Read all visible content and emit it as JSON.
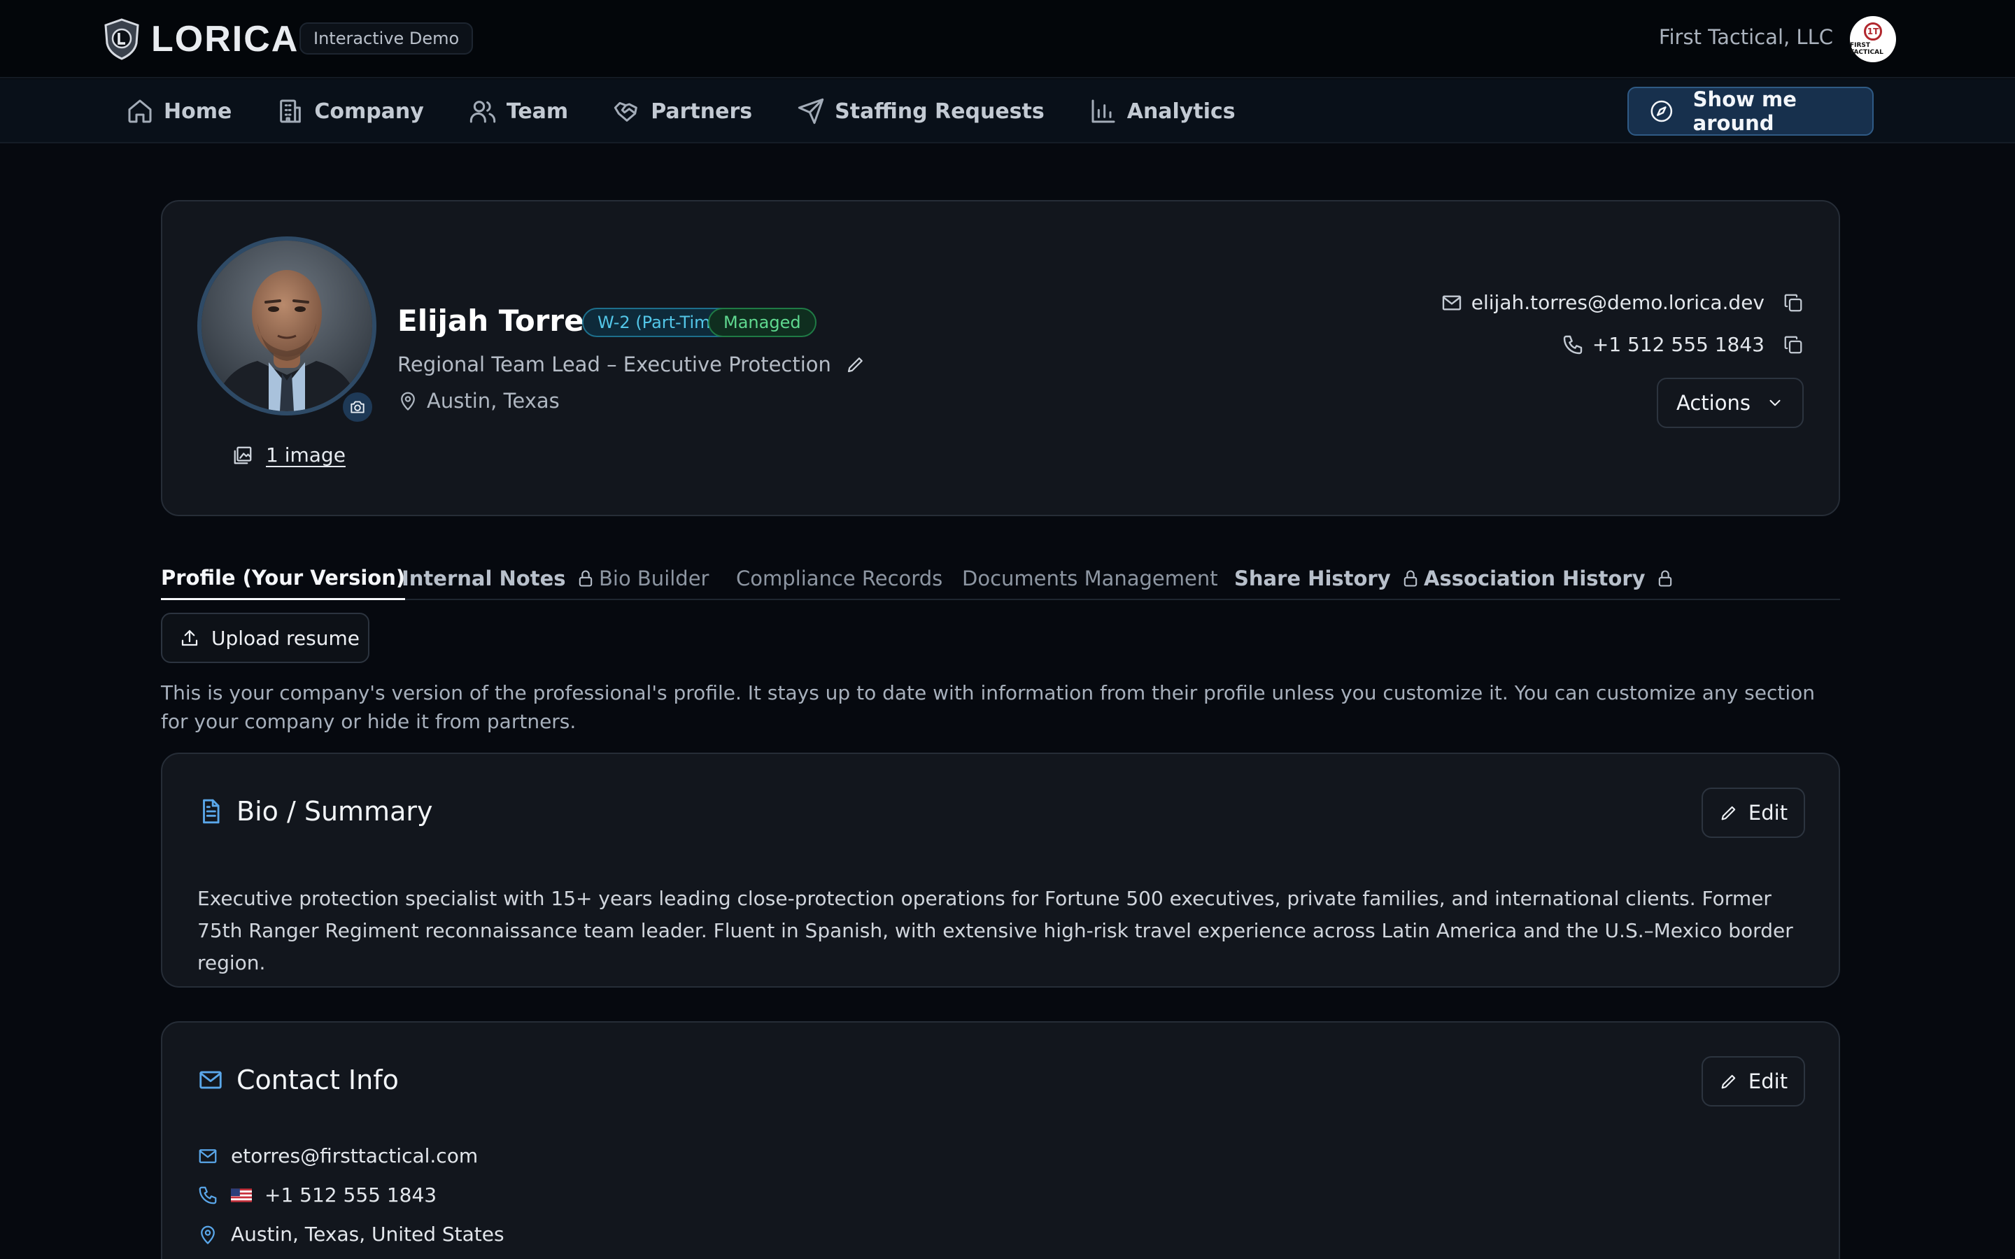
{
  "header": {
    "logo_text": "LORICA",
    "demo_badge": "Interactive Demo",
    "company_name": "First Tactical, LLC",
    "company_avatar_text": "FIRST TACTICAL",
    "company_avatar_mark": "1T"
  },
  "nav": {
    "items": [
      {
        "label": "Home",
        "icon": "home-icon"
      },
      {
        "label": "Company",
        "icon": "building-icon"
      },
      {
        "label": "Team",
        "icon": "users-icon"
      },
      {
        "label": "Partners",
        "icon": "handshake-icon"
      },
      {
        "label": "Staffing Requests",
        "icon": "send-icon"
      },
      {
        "label": "Analytics",
        "icon": "bar-chart-icon"
      }
    ],
    "tour_button": "Show me around"
  },
  "profile": {
    "name": "Elijah Torres",
    "badges": {
      "employment": "W-2 (Part-Time)",
      "status": "Managed"
    },
    "title": "Regional Team Lead – Executive Protection",
    "location": "Austin, Texas",
    "images_link": "1 image",
    "email": "elijah.torres@demo.lorica.dev",
    "phone": "+1 512 555 1843",
    "actions_label": "Actions"
  },
  "tabs": [
    {
      "label": "Profile (Your Version)",
      "state": "active"
    },
    {
      "label": "Internal Notes",
      "state": "locked"
    },
    {
      "label": "Bio Builder",
      "state": "normal"
    },
    {
      "label": "Compliance Records",
      "state": "normal"
    },
    {
      "label": "Documents Management",
      "state": "normal"
    },
    {
      "label": "Share History",
      "state": "locked"
    },
    {
      "label": "Association History",
      "state": "locked"
    }
  ],
  "upload_label": "Upload resume",
  "intro_text": "This is your company's version of the professional's profile. It stays up to date with information from their profile unless you customize it. You can customize any section for your company or hide it from partners.",
  "bio_section": {
    "title": "Bio / Summary",
    "edit_label": "Edit",
    "text": "Executive protection specialist with 15+ years leading close-protection operations for Fortune 500 executives, private families, and international clients. Former 75th Ranger Regiment reconnaissance team leader. Fluent in Spanish, with extensive high-risk travel experience across Latin America and the U.S.–Mexico border region."
  },
  "contact_section": {
    "title": "Contact Info",
    "edit_label": "Edit",
    "email": "etorres@firsttactical.com",
    "phone": "+1 512 555 1843",
    "address": "Austin, Texas, United States"
  },
  "colors": {
    "accent_blue": "#5aa7ea",
    "badge_cyan": "#53c6e8",
    "badge_green": "#5fd88f",
    "background": "#06090f",
    "card": "#12161d"
  }
}
